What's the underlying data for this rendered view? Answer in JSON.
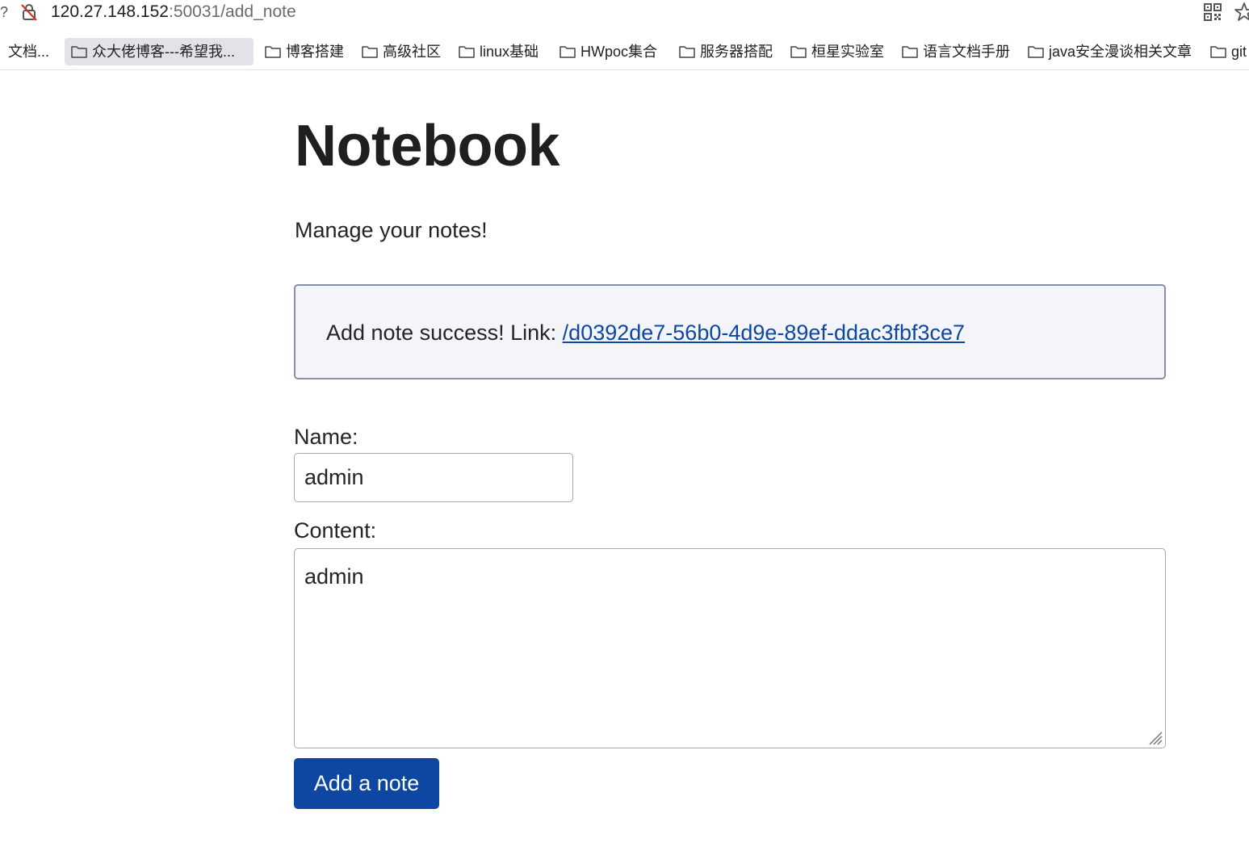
{
  "browser": {
    "url_host": "120.27.148.152",
    "url_path": ":50031/add_note",
    "left_fragment": "?",
    "icons": {
      "security": "not-secure-lock-icon",
      "qr": "qr-code-icon",
      "bookmark": "star-icon"
    }
  },
  "bookmarks": [
    {
      "label": "文档...",
      "folder": false
    },
    {
      "label": "众大佬博客---希望我...",
      "folder": true,
      "active": true
    },
    {
      "label": "博客搭建",
      "folder": true
    },
    {
      "label": "高级社区",
      "folder": true
    },
    {
      "label": "linux基础",
      "folder": true
    },
    {
      "label": "HWpoc集合",
      "folder": true
    },
    {
      "label": "服务器搭配",
      "folder": true
    },
    {
      "label": "桓星实验室",
      "folder": true
    },
    {
      "label": "语言文档手册",
      "folder": true
    },
    {
      "label": "java安全漫谈相关文章",
      "folder": true
    },
    {
      "label": "git",
      "folder": true
    }
  ],
  "page": {
    "title": "Notebook",
    "subtitle": "Manage your notes!",
    "alert": {
      "text": "Add note success! Link: ",
      "link": "/d0392de7-56b0-4d9e-89ef-ddac3fbf3ce7"
    },
    "form": {
      "name_label": "Name:",
      "name_value": "admin",
      "content_label": "Content:",
      "content_value": "admin",
      "submit_label": "Add a note"
    }
  },
  "colors": {
    "accent": "#0d47a1",
    "alert_bg": "#f3f5fb",
    "alert_border": "#8a8fa8"
  }
}
